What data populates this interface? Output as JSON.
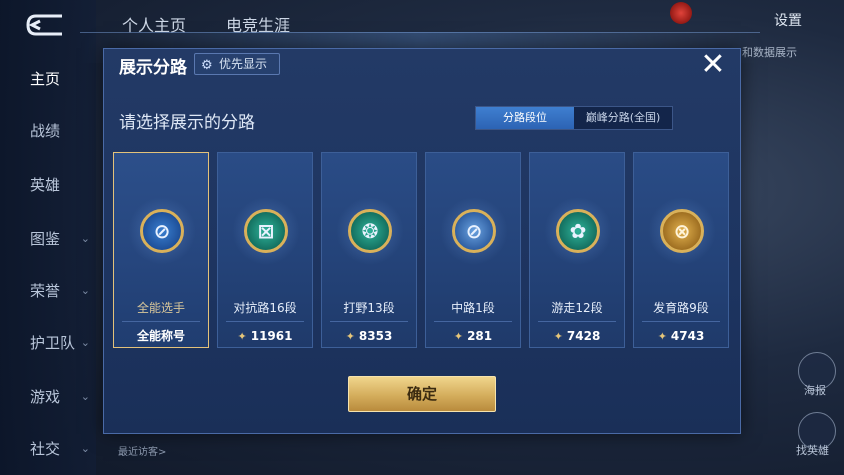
{
  "nav": {
    "items": [
      {
        "label": "主页",
        "active": true,
        "arrow": false
      },
      {
        "label": "战绩",
        "active": false,
        "arrow": false
      },
      {
        "label": "英雄",
        "active": false,
        "arrow": false
      },
      {
        "label": "图鉴",
        "active": false,
        "arrow": true
      },
      {
        "label": "荣誉",
        "active": false,
        "arrow": true
      },
      {
        "label": "护卫队",
        "active": false,
        "arrow": true
      },
      {
        "label": "游戏",
        "active": false,
        "arrow": true
      },
      {
        "label": "社交",
        "active": false,
        "arrow": true
      }
    ],
    "arrow_glyph": "⌄"
  },
  "header": {
    "tabs": [
      "个人主页",
      "电竞生涯"
    ],
    "settings": "设置",
    "right_text": "和数据展示"
  },
  "background": {
    "recent_visitor": "最近访客>",
    "right_buttons": [
      "海报",
      "找英雄"
    ]
  },
  "modal": {
    "title": "展示分路",
    "priority_label": "优先显示",
    "close_glyph": "✕",
    "subtitle": "请选择展示的分路",
    "segments": [
      "分路段位",
      "巅峰分路(全国)"
    ],
    "active_segment": 0,
    "cards": [
      {
        "label": "全能选手",
        "footer": "全能称号",
        "selected": true,
        "icon": "all-round-icon",
        "color": "blue",
        "glyph": "⊘"
      },
      {
        "label": "对抗路16段",
        "footer": "11961",
        "selected": false,
        "icon": "clash-lane-icon",
        "color": "green",
        "glyph": "⊠"
      },
      {
        "label": "打野13段",
        "footer": "8353",
        "selected": false,
        "icon": "jungle-icon",
        "color": "green",
        "glyph": "❂"
      },
      {
        "label": "中路1段",
        "footer": "281",
        "selected": false,
        "icon": "mid-lane-icon",
        "color": "silver",
        "glyph": "⊘"
      },
      {
        "label": "游走12段",
        "footer": "7428",
        "selected": false,
        "icon": "roam-icon",
        "color": "green",
        "glyph": "✿"
      },
      {
        "label": "发育路9段",
        "footer": "4743",
        "selected": false,
        "icon": "farm-lane-icon",
        "color": "gold",
        "glyph": "⊗"
      }
    ],
    "score_glyph": "✦",
    "confirm": "确定"
  }
}
